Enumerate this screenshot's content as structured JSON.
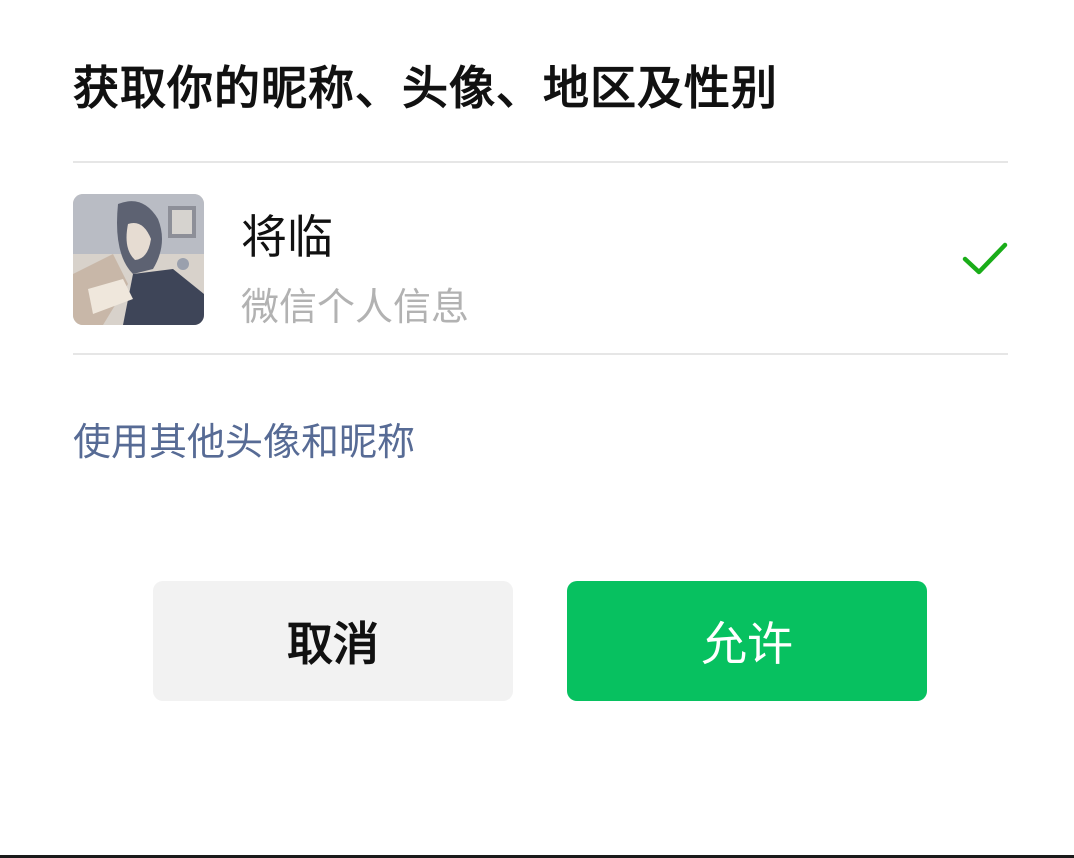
{
  "dialog": {
    "title": "获取你的昵称、头像、地区及性别"
  },
  "account": {
    "nickname": "将临",
    "subtitle": "微信个人信息",
    "selected": true
  },
  "links": {
    "other_profile": "使用其他头像和昵称"
  },
  "buttons": {
    "cancel_label": "取消",
    "allow_label": "允许"
  },
  "colors": {
    "accent_green": "#07c160",
    "link_blue": "#576b95",
    "check_green": "#1aad19"
  },
  "icons": {
    "avatar": "profile-photo",
    "check": "checkmark-icon"
  }
}
